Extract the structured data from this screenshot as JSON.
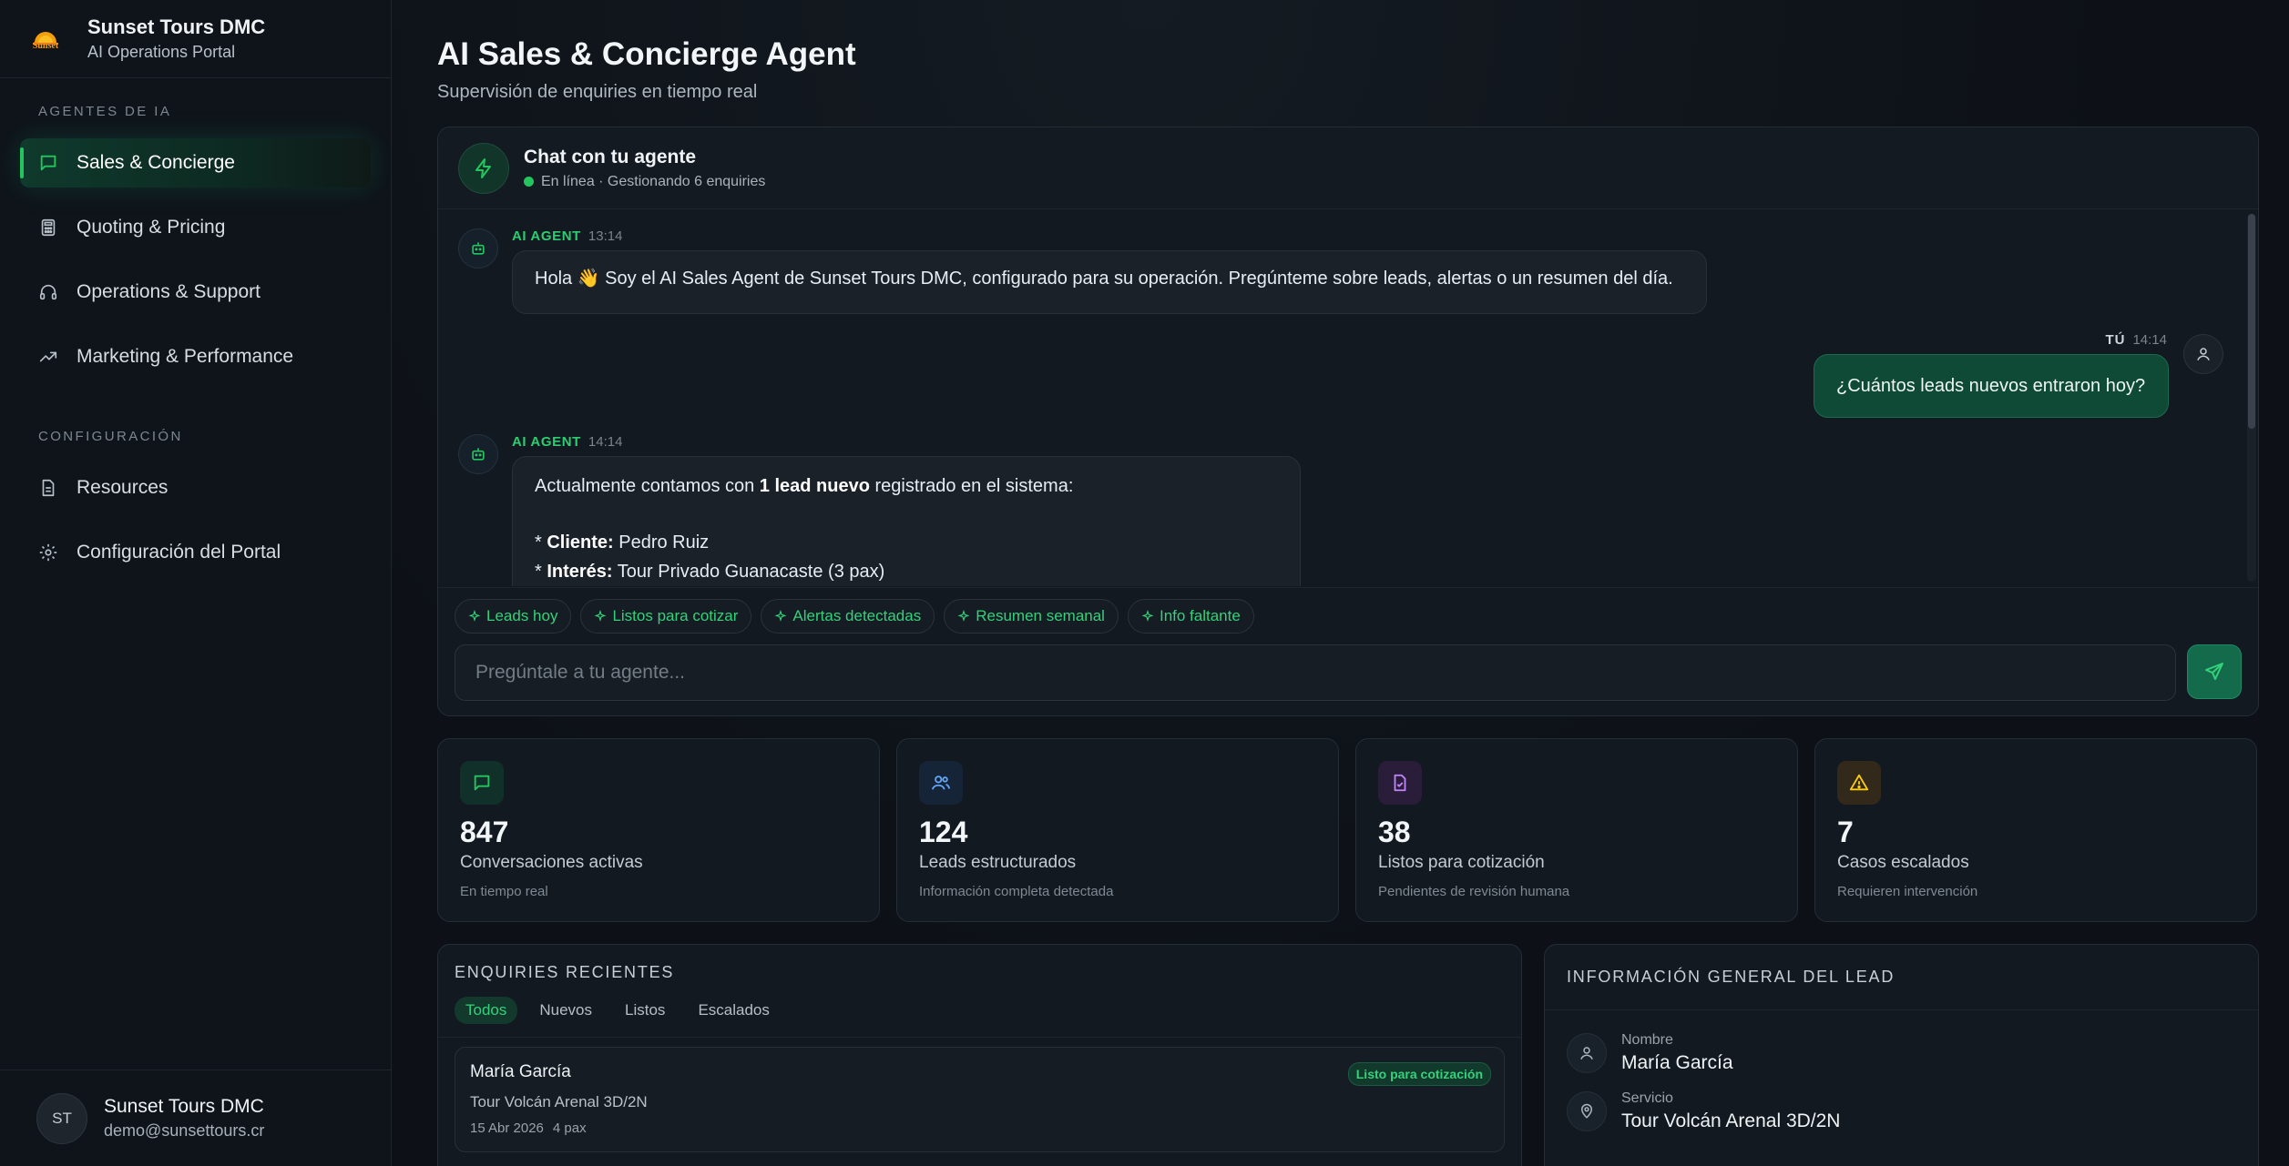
{
  "brand": {
    "name": "Sunset Tours DMC",
    "subtitle": "AI Operations Portal",
    "logo_text": "Sunset"
  },
  "sidebar": {
    "section_agents": "AGENTES DE IA",
    "agents": [
      {
        "label": "Sales & Concierge",
        "icon": "chat-icon",
        "active": true
      },
      {
        "label": "Quoting & Pricing",
        "icon": "calculator-icon"
      },
      {
        "label": "Operations & Support",
        "icon": "headset-icon"
      },
      {
        "label": "Marketing & Performance",
        "icon": "trend-icon"
      }
    ],
    "section_config": "CONFIGURACIÓN",
    "config": [
      {
        "label": "Resources",
        "icon": "document-icon"
      },
      {
        "label": "Configuración del Portal",
        "icon": "gear-icon"
      }
    ],
    "footer": {
      "initials": "ST",
      "name": "Sunset Tours DMC",
      "email": "demo@sunsettours.cr"
    }
  },
  "header": {
    "title": "AI Sales & Concierge Agent",
    "subtitle": "Supervisión de enquiries en tiempo real"
  },
  "chat": {
    "title": "Chat con tu agente",
    "status": "En línea · Gestionando 6 enquiries",
    "messages": [
      {
        "who": "AI AGENT",
        "time": "13:14",
        "text": "Hola 👋 Soy el AI Sales Agent de Sunset Tours DMC, configurado para su operación. Pregúnteme sobre leads, alertas o un resumen del día."
      },
      {
        "who": "TÚ",
        "time": "14:14",
        "text": "¿Cuántos leads nuevos entraron hoy?"
      },
      {
        "who": "AI AGENT",
        "time": "14:14",
        "intro_pre": "Actualmente contamos con ",
        "intro_bold": "1 lead nuevo",
        "intro_post": " registrado en el sistema:",
        "line1_label": "Cliente:",
        "line1_value": " Pedro Ruiz",
        "line2_label": "Interés:",
        "line2_value": " Tour Privado Guanacaste (3 pax)"
      }
    ],
    "chips": [
      "Leads hoy",
      "Listos para cotizar",
      "Alertas detectadas",
      "Resumen semanal",
      "Info faltante"
    ],
    "input_placeholder": "Pregúntale a tu agente..."
  },
  "stats": [
    {
      "value": "847",
      "label": "Conversaciones activas",
      "note": "En tiempo real",
      "icon": "chat-icon",
      "color": "#22c55e",
      "bg": "#12302a"
    },
    {
      "value": "124",
      "label": "Leads estructurados",
      "note": "Información completa detectada",
      "icon": "users-icon",
      "color": "#60a5fa",
      "bg": "#162437"
    },
    {
      "value": "38",
      "label": "Listos para cotización",
      "note": "Pendientes de revisión humana",
      "icon": "file-check-icon",
      "color": "#c084fc",
      "bg": "#2a1d3a"
    },
    {
      "value": "7",
      "label": "Casos escalados",
      "note": "Requieren intervención",
      "icon": "alert-icon",
      "color": "#facc15",
      "bg": "#33291a"
    }
  ],
  "enquiries": {
    "title": "ENQUIRIES RECIENTES",
    "tabs": [
      "Todos",
      "Nuevos",
      "Listos",
      "Escalados"
    ],
    "items": [
      {
        "name": "María García",
        "status": "Listo para cotización",
        "tour": "Tour Volcán Arenal 3D/2N",
        "date": "15 Abr 2026",
        "pax": "4 pax"
      }
    ]
  },
  "lead": {
    "title": "INFORMACIÓN GENERAL DEL LEAD",
    "fields": [
      {
        "key": "Nombre",
        "value": "María García",
        "icon": "user-icon"
      },
      {
        "key": "Servicio",
        "value": "Tour Volcán Arenal 3D/2N",
        "icon": "pin-icon"
      }
    ]
  }
}
